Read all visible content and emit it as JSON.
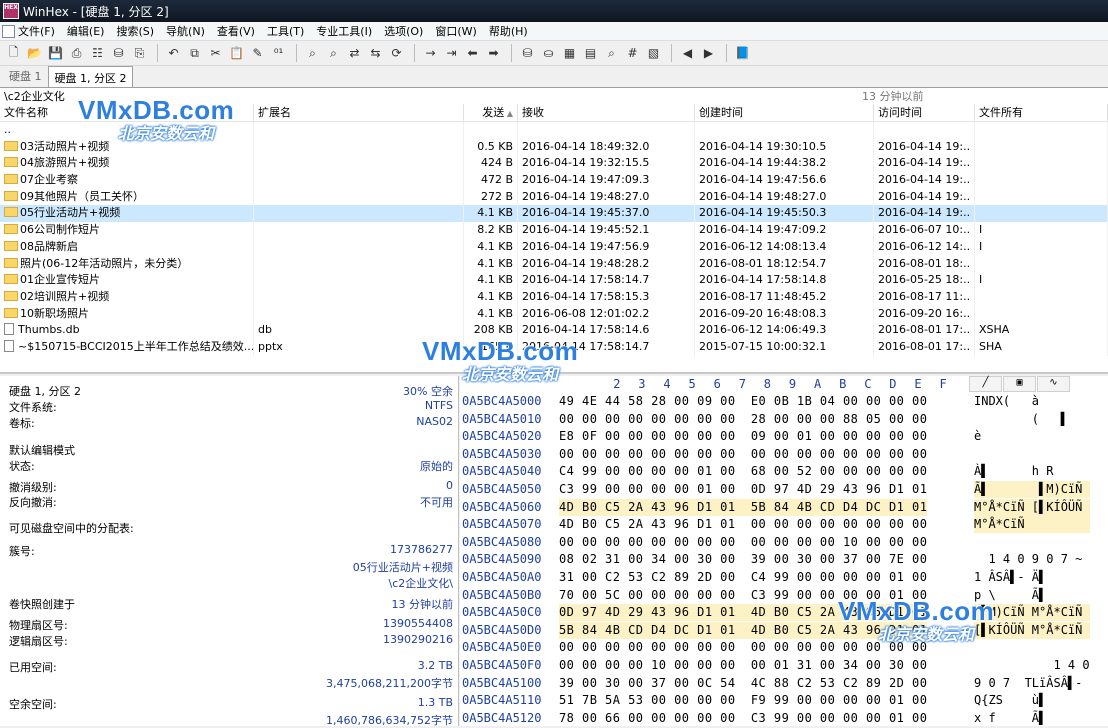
{
  "window": {
    "title": "WinHex - [硬盘 1, 分区 2]",
    "app_icon_text": "HEX"
  },
  "menu": [
    "文件(F)",
    "编辑(E)",
    "搜索(S)",
    "导航(N)",
    "查看(V)",
    "工具(T)",
    "专业工具(I)",
    "选项(O)",
    "窗口(W)",
    "帮助(H)"
  ],
  "toolbar": {
    "groups": [
      [
        "new-file-icon",
        "open-file-icon",
        "save-icon",
        "print-icon",
        "properties-icon",
        "open-disk-icon",
        "save-all-icon"
      ],
      [
        "undo-icon",
        "copy-block-icon",
        "cut-icon",
        "paste-icon",
        "write-icon",
        "binary-icon"
      ],
      [
        "find-text-icon",
        "find-hex-icon",
        "replace-text-icon",
        "replace-hex-icon",
        "find-again-icon"
      ],
      [
        "goto-offset-icon",
        "goto-sector-icon",
        "back-icon",
        "forward-icon"
      ],
      [
        "open-disk-2-icon",
        "disk-clone-icon",
        "ram-icon",
        "calculator-icon",
        "search-icon",
        "hash-icon",
        "template-icon"
      ],
      [
        "prev-icon",
        "next-icon"
      ],
      [
        "help-book-icon"
      ]
    ]
  },
  "tabs": [
    "硬盘 1",
    "硬盘 1, 分区 2"
  ],
  "path": {
    "current": "\\c2企业文化",
    "snapshot_time": "13 分钟以前"
  },
  "file_list": {
    "columns": [
      "文件名称",
      "扩展名",
      "发送",
      "接收",
      "创建时间",
      "访问时间",
      "文件所有"
    ],
    "rows": [
      {
        "name": "..",
        "ext": "",
        "size": "",
        "recv": "",
        "created": "",
        "accessed": "",
        "owner": "",
        "type": "none"
      },
      {
        "name": "03活动照片+视频",
        "ext": "",
        "size": "0.5 KB",
        "recv": "2016-04-14   18:49:32.0",
        "created": "2016-04-14   19:30:10.5",
        "accessed": "2016-04-14   19:..",
        "owner": "",
        "type": "folder"
      },
      {
        "name": "04旅游照片+视频",
        "ext": "",
        "size": "424 B",
        "recv": "2016-04-14   19:32:15.5",
        "created": "2016-04-14   19:44:38.2",
        "accessed": "2016-04-14   19:..",
        "owner": "",
        "type": "folder"
      },
      {
        "name": "07企业考察",
        "ext": "",
        "size": "472 B",
        "recv": "2016-04-14   19:47:09.3",
        "created": "2016-04-14   19:47:56.6",
        "accessed": "2016-04-14   19:..",
        "owner": "",
        "type": "folder"
      },
      {
        "name": "09其他照片（员工关怀）",
        "ext": "",
        "size": "272 B",
        "recv": "2016-04-14   19:48:27.0",
        "created": "2016-04-14   19:48:27.0",
        "accessed": "2016-04-14   19:..",
        "owner": "",
        "type": "folder"
      },
      {
        "name": "05行业活动片+视频",
        "ext": "",
        "size": "4.1 KB",
        "recv": "2016-04-14   19:45:37.0",
        "created": "2016-04-14   19:45:50.3",
        "accessed": "2016-04-14   19:..",
        "owner": "",
        "type": "folder",
        "selected": true
      },
      {
        "name": "06公司制作短片",
        "ext": "",
        "size": "8.2 KB",
        "recv": "2016-04-14   19:45:52.1",
        "created": "2016-04-14   19:47:09.2",
        "accessed": "2016-06-07   10:..",
        "owner": "I",
        "type": "folder"
      },
      {
        "name": "08品牌新启",
        "ext": "",
        "size": "4.1 KB",
        "recv": "2016-04-14   19:47:56.9",
        "created": "2016-06-12   14:08:13.4",
        "accessed": "2016-06-12   14:..",
        "owner": "I",
        "type": "folder"
      },
      {
        "name": "照片(06-12年活动照片，未分类）",
        "ext": "",
        "size": "4.1 KB",
        "recv": "2016-04-14   19:48:28.2",
        "created": "2016-08-01   18:12:54.7",
        "accessed": "2016-08-01   18:..",
        "owner": "",
        "type": "folder"
      },
      {
        "name": "01企业宣传短片",
        "ext": "",
        "size": "4.1 KB",
        "recv": "2016-04-14   17:58:14.7",
        "created": "2016-04-14   17:58:14.8",
        "accessed": "2016-05-25   18:..",
        "owner": "I",
        "type": "folder"
      },
      {
        "name": "02培训照片+视频",
        "ext": "",
        "size": "4.1 KB",
        "recv": "2016-04-14   17:58:15.3",
        "created": "2016-08-17   11:48:45.2",
        "accessed": "2016-08-17   11:..",
        "owner": "",
        "type": "folder"
      },
      {
        "name": "10新职场照片",
        "ext": "",
        "size": "4.1 KB",
        "recv": "2016-06-08   12:01:02.2",
        "created": "2016-09-20   16:48:08.3",
        "accessed": "2016-09-20   16:..",
        "owner": "",
        "type": "folder"
      },
      {
        "name": "Thumbs.db",
        "ext": "db",
        "size": "208 KB",
        "recv": "2016-04-14   17:58:14.6",
        "created": "2016-06-12   14:06:49.3",
        "accessed": "2016-08-01   17:..",
        "owner": "XSHA",
        "type": "file"
      },
      {
        "name": "~$150715-BCCI2015上半年工作总结及绩效...",
        "ext": "pptx",
        "size": "165 B",
        "recv": "2016-04-14   17:58:14.7",
        "created": "2015-07-15   10:00:32.1",
        "accessed": "2016-08-01   17:..",
        "owner": "SHA",
        "type": "file"
      }
    ]
  },
  "info_panel": {
    "items": [
      {
        "label": "硬盘 1, 分区 2",
        "value": "30% 空余"
      },
      {
        "label": "文件系统:",
        "value": "NTFS"
      },
      {
        "label": "卷标:",
        "value": "NAS02"
      },
      {
        "label": "默认编辑模式",
        "value": ""
      },
      {
        "label": "状态:",
        "value": "原始的"
      },
      {
        "label": "撤消级别:",
        "value": "0"
      },
      {
        "label": "反向撤消:",
        "value": "不可用"
      },
      {
        "label": "可见磁盘空间中的分配表:",
        "value": ""
      },
      {
        "label": "簇号:",
        "value": "173786277"
      },
      {
        "label": "",
        "value": "05行业活动片+视频"
      },
      {
        "label": "",
        "value": "\\c2企业文化\\"
      },
      {
        "label": "卷快照创建于",
        "value": "13 分钟以前"
      },
      {
        "label": "物理扇区号:",
        "value": "1390554408"
      },
      {
        "label": "逻辑扇区号:",
        "value": "1390290216"
      },
      {
        "label": "已用空间:",
        "value": "3.2 TB"
      },
      {
        "label": "",
        "value": "3,475,068,211,200字节"
      },
      {
        "label": "空余空间:",
        "value": "1.3 TB"
      },
      {
        "label": "",
        "value": "1,460,786,634,752字节"
      }
    ]
  },
  "hex_view": {
    "columns": [
      "2",
      "3",
      "4",
      "5",
      "6",
      "7",
      "8",
      "9",
      "A",
      "B",
      "C",
      "D",
      "E",
      "F"
    ],
    "rows": [
      {
        "offset": "0A5BC4A5000",
        "bytes": "49 4E 44 58 28 00 09 00  E0 0B 1B 04 00 00 00 00",
        "ascii": "INDX(   à       "
      },
      {
        "offset": "0A5BC4A5010",
        "bytes": "00 00 00 00 00 00 00 00  28 00 00 00 88 05 00 00",
        "ascii": "        (   ▌   "
      },
      {
        "offset": "0A5BC4A5020",
        "bytes": "E8 0F 00 00 00 00 00 00  09 00 01 00 00 00 00 00",
        "ascii": "è               "
      },
      {
        "offset": "0A5BC4A5030",
        "bytes": "00 00 00 00 00 00 00 00  00 00 00 00 00 00 00 00",
        "ascii": "                "
      },
      {
        "offset": "0A5BC4A5040",
        "bytes": "C4 99 00 00 00 00 01 00  68 00 52 00 00 00 00 00",
        "ascii": "À▌      h R     "
      },
      {
        "offset": "0A5BC4A5050",
        "bytes": "C3 99 00 00 00 00 01 00  0D 97 4D 29 43 96 D1 01",
        "ascii": "Ã▌       ▌M)CïÑ ",
        "hl_from": 8
      },
      {
        "offset": "0A5BC4A5060",
        "bytes": "4D B0 C5 2A 43 96 D1 01  5B 84 4B CD D4 DC D1 01",
        "ascii": "M°Å*CïÑ [▌KÍÔÜÑ ",
        "hl_all": true
      },
      {
        "offset": "0A5BC4A5070",
        "bytes": "4D B0 C5 2A 43 96 D1 01  00 00 00 00 00 00 00 00",
        "ascii": "M°Å*CïÑ         ",
        "hl_to": 8
      },
      {
        "offset": "0A5BC4A5080",
        "bytes": "00 00 00 00 00 00 00 00  00 00 00 00 10 00 00 00",
        "ascii": "                "
      },
      {
        "offset": "0A5BC4A5090",
        "bytes": "08 02 31 00 34 00 30 00  39 00 30 00 37 00 7E 00",
        "ascii": "  1 4 0 9 0 7 ~ "
      },
      {
        "offset": "0A5BC4A50A0",
        "bytes": "31 00 C2 53 C2 89 2D 00  C4 99 00 00 00 00 01 00",
        "ascii": "1 ÂSÂ▌- Ä▌      "
      },
      {
        "offset": "0A5BC4A50B0",
        "bytes": "70 00 5C 00 00 00 00 00  C3 99 00 00 00 00 01 00",
        "ascii": "p \\     Ã▌      "
      },
      {
        "offset": "0A5BC4A50C0",
        "bytes": "0D 97 4D 29 43 96 D1 01  4D B0 C5 2A 43 96 D1 01",
        "ascii": " ▌M)CïÑ M°Å*CïÑ ",
        "hl_all": true
      },
      {
        "offset": "0A5BC4A50D0",
        "bytes": "5B 84 4B CD D4 DC D1 01  4D B0 C5 2A 43 96 D1 01",
        "ascii": "[▌KÍÔÜÑ M°Å*CïÑ ",
        "hl_all": true
      },
      {
        "offset": "0A5BC4A50E0",
        "bytes": "00 00 00 00 00 00 00 00  00 00 00 00 00 00 00 00",
        "ascii": "                "
      },
      {
        "offset": "0A5BC4A50F0",
        "bytes": "00 00 00 00 10 00 00 00  00 01 31 00 34 00 30 00",
        "ascii": "           1 4 0"
      },
      {
        "offset": "0A5BC4A5100",
        "bytes": "39 00 30 00 37 00 0C 54  4C 88 C2 53 C2 89 2D 00",
        "ascii": "9 0 7  TLïÂSÂ▌- "
      },
      {
        "offset": "0A5BC4A5110",
        "bytes": "51 7B 5A 53 00 00 00 00  F9 99 00 00 00 00 01 00",
        "ascii": "Q{ZS    ù▌      "
      },
      {
        "offset": "0A5BC4A5120",
        "bytes": "78 00 66 00 00 00 00 00  C3 99 00 00 00 00 01 00",
        "ascii": "x f     Ã▌      "
      }
    ]
  },
  "watermarks": [
    {
      "line1": "VMxDB.com",
      "line2": "北京安数云和"
    },
    {
      "line1": "VMxDB.com",
      "line2": "北京安数云和"
    },
    {
      "line1": "VMxDB.com",
      "line2": "北京安数云和"
    }
  ]
}
